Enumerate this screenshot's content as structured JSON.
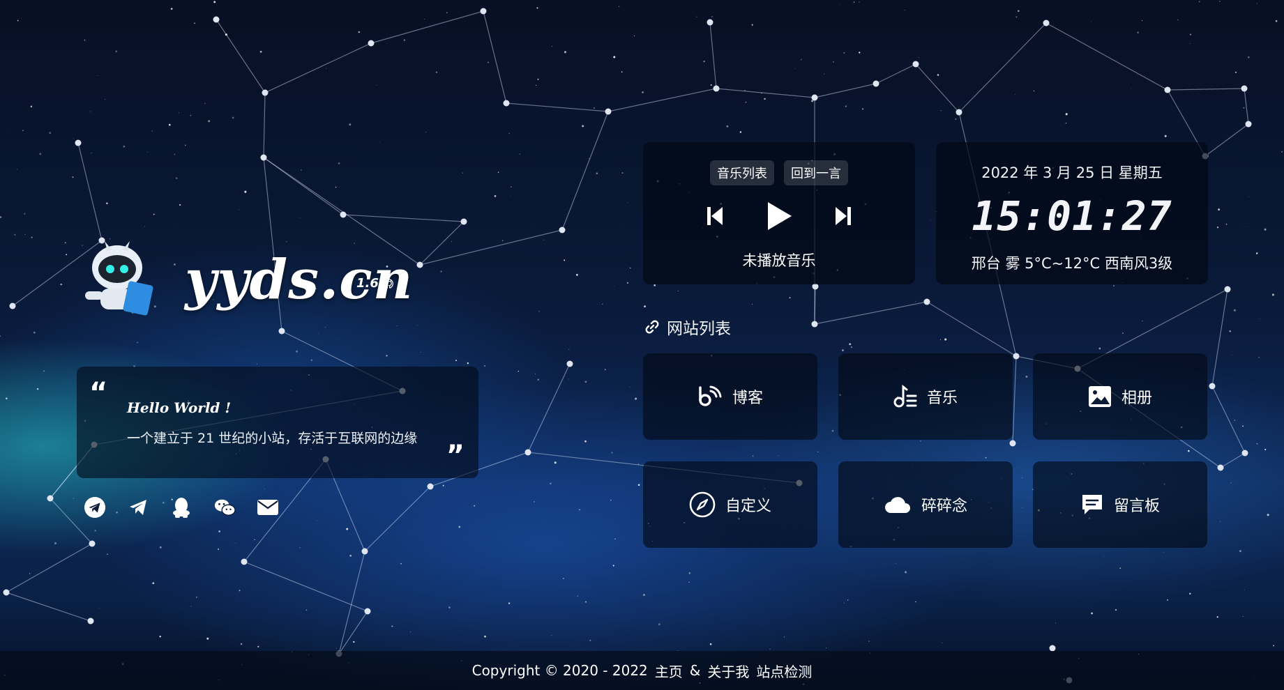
{
  "site": {
    "title": "yyds.cn",
    "version": "v 1.6"
  },
  "quote": {
    "hello": "Hello World !",
    "text": "一个建立于 21 世纪的小站，存活于互联网的边缘"
  },
  "social": [
    {
      "icon": "telegram-circle-icon"
    },
    {
      "icon": "telegram-plane-icon"
    },
    {
      "icon": "qq-icon"
    },
    {
      "icon": "wechat-icon"
    },
    {
      "icon": "email-icon"
    }
  ],
  "music": {
    "tab_list": "音乐列表",
    "tab_back": "回到一言",
    "status": "未播放音乐"
  },
  "time": {
    "date": "2022 年 3 月 25 日 星期五",
    "clock": "15:01:27",
    "weather": "邢台 雾 5°C~12°C 西南风3级"
  },
  "sites": {
    "header": "网站列表",
    "items": [
      {
        "label": "博客",
        "icon": "blog-icon"
      },
      {
        "label": "音乐",
        "icon": "music-icon"
      },
      {
        "label": "相册",
        "icon": "image-icon"
      },
      {
        "label": "自定义",
        "icon": "compass-icon"
      },
      {
        "label": "碎碎念",
        "icon": "cloud-icon"
      },
      {
        "label": "留言板",
        "icon": "message-icon"
      }
    ]
  },
  "footer": {
    "copyright": "Copyright © 2020 - 2022",
    "home": "主页",
    "amp": "&",
    "about": "关于我",
    "status": "站点检测"
  }
}
